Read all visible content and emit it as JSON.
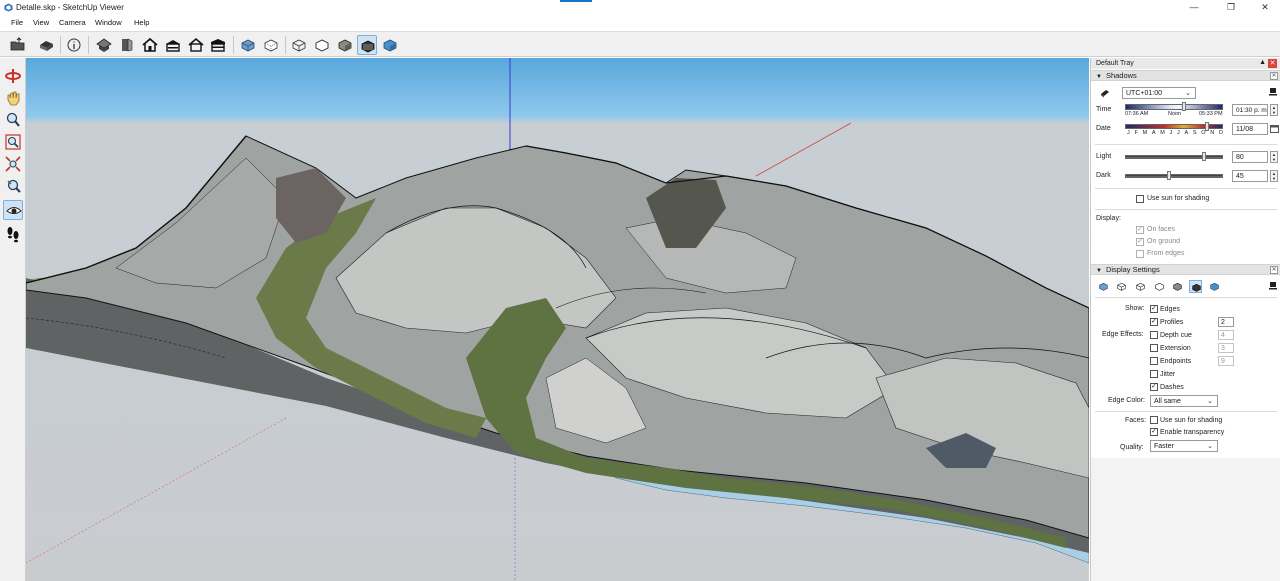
{
  "window": {
    "title": "Detalle.skp - SketchUp Viewer",
    "controls": [
      "minimize-icon",
      "maximize-icon",
      "close-icon"
    ]
  },
  "menu": [
    "File",
    "View",
    "Camera",
    "Window",
    "Help"
  ],
  "toolbar": {
    "tools": [
      "open-file-icon",
      "print-icon",
      "model-info-icon",
      "iso-view-icon",
      "top-view-icon",
      "front-view-icon",
      "right-view-icon",
      "back-view-icon",
      "left-view-icon",
      "xray-icon",
      "back-edges-icon",
      "wireframe-icon",
      "hidden-line-icon",
      "shaded-icon",
      "shaded-textures-icon",
      "monochrome-icon"
    ],
    "active": "shaded-textures-icon"
  },
  "left_tools": [
    "orbit-icon",
    "pan-icon",
    "zoom-icon",
    "zoom-window-icon",
    "zoom-extents-icon",
    "previous-view-icon",
    "look-around-icon",
    "walk-icon"
  ],
  "tray": {
    "title": "Default Tray",
    "shadows": {
      "header": "Shadows",
      "timezone": "UTC+01:00",
      "time_label": "Time",
      "time_ticks": [
        "07:36 AM",
        "Noon",
        "05:33 PM"
      ],
      "time_value": "01:30 p. m.",
      "time_position": 0.6,
      "date_label": "Date",
      "months": [
        "J",
        "F",
        "M",
        "A",
        "M",
        "J",
        "J",
        "A",
        "S",
        "O",
        "N",
        "D"
      ],
      "date_value": "11/08",
      "date_position": 0.84,
      "light_label": "Light",
      "light_value": "80",
      "dark_label": "Dark",
      "dark_value": "45",
      "use_sun_label": "Use sun for shading",
      "display_label": "Display:",
      "on_faces": "On faces",
      "on_ground": "On ground",
      "from_edges": "From edges"
    },
    "display_settings": {
      "header": "Display Settings",
      "show_label": "Show:",
      "edges": "Edges",
      "profiles": "Profiles",
      "profiles_value": "2",
      "edge_effects_label": "Edge Effects:",
      "depth_cue": "Depth cue",
      "depth_cue_value": "4",
      "extension": "Extension",
      "extension_value": "3",
      "endpoints": "Endpoints",
      "endpoints_value": "9",
      "jitter": "Jitter",
      "dashes": "Dashes",
      "edge_color_label": "Edge Color:",
      "edge_color_value": "All same",
      "faces_label": "Faces:",
      "faces_use_sun": "Use sun for shading",
      "enable_transparency": "Enable transparency",
      "quality_label": "Quality:",
      "quality_value": "Faster"
    }
  }
}
